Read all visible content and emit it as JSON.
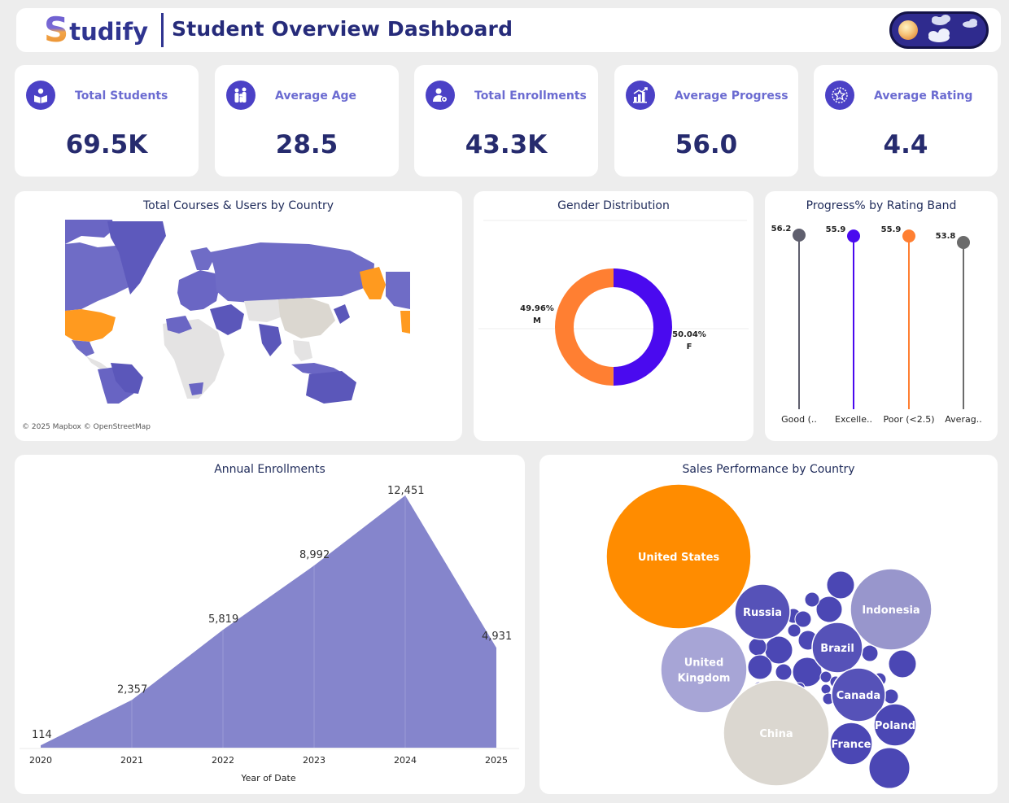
{
  "header": {
    "logo_initial": "S",
    "logo_rest": "tudify",
    "title": "Student Overview Dashboard"
  },
  "kpis": [
    {
      "label": "Total Students",
      "value": "69.5K",
      "icon": "reader-icon"
    },
    {
      "label": "Average Age",
      "value": "28.5",
      "icon": "family-icon"
    },
    {
      "label": "Total Enrollments",
      "value": "43.3K",
      "icon": "user-gear-icon"
    },
    {
      "label": "Average Progress",
      "value": "56.0",
      "icon": "bar-growth-icon"
    },
    {
      "label": "Average Rating",
      "value": "4.4",
      "icon": "star-badge-icon"
    }
  ],
  "map": {
    "title": "Total Courses & Users by Country",
    "credit": "© 2025 Mapbox  © OpenStreetMap"
  },
  "colors": {
    "accent": "#4b41c6",
    "purple": "#5a55b8",
    "orange": "#ff8c00",
    "gray": "#dbd7d0",
    "male": "#ff7f32",
    "female": "#4a0aef"
  },
  "chart_data": [
    {
      "type": "pie",
      "title": "Gender Distribution",
      "categories": [
        "M",
        "F"
      ],
      "values": [
        49.96,
        50.04
      ],
      "value_labels": [
        "49.96%",
        "50.04%"
      ],
      "colors": [
        "#ff7f32",
        "#4a0aef"
      ]
    },
    {
      "type": "scatter",
      "title": "Progress% by Rating Band",
      "categories": [
        "Good (..",
        "Excelle..",
        "Poor (<2.5)",
        "Averag.."
      ],
      "values": [
        56.2,
        55.9,
        55.9,
        53.8
      ],
      "value_labels": [
        "56.2",
        "55.9",
        "55.9",
        "53.8"
      ],
      "colors": [
        "#5f5f6e",
        "#4a0aef",
        "#ff7f32",
        "#6b6b6b"
      ]
    },
    {
      "type": "area",
      "title": "Annual Enrollments",
      "xlabel": "Year of Date",
      "categories": [
        "2020",
        "2021",
        "2022",
        "2023",
        "2024",
        "2025"
      ],
      "values": [
        114,
        2357,
        5819,
        8992,
        12451,
        4931
      ],
      "value_labels": [
        "114",
        "2,357",
        "5,819",
        "8,992",
        "12,451",
        "4,931"
      ],
      "ylim": [
        0,
        12451
      ]
    },
    {
      "type": "scatter",
      "title": "Sales Performance by Country",
      "labels": [
        "United States",
        "Indonesia",
        "United Kingdom",
        "China",
        "Russia",
        "Brazil",
        "Canada",
        "Poland",
        "France"
      ]
    }
  ]
}
